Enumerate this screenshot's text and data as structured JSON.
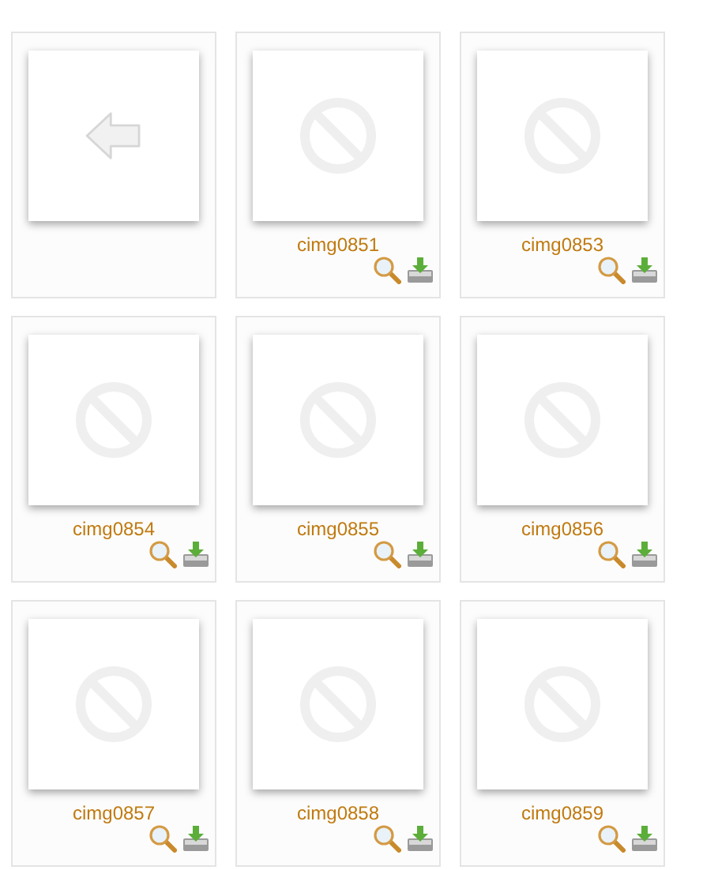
{
  "items": [
    {
      "kind": "back"
    },
    {
      "kind": "file",
      "name": "cimg0851"
    },
    {
      "kind": "file",
      "name": "cimg0853"
    },
    {
      "kind": "file",
      "name": "cimg0854"
    },
    {
      "kind": "file",
      "name": "cimg0855"
    },
    {
      "kind": "file",
      "name": "cimg0856"
    },
    {
      "kind": "file",
      "name": "cimg0857"
    },
    {
      "kind": "file",
      "name": "cimg0858"
    },
    {
      "kind": "file",
      "name": "cimg0859"
    }
  ]
}
